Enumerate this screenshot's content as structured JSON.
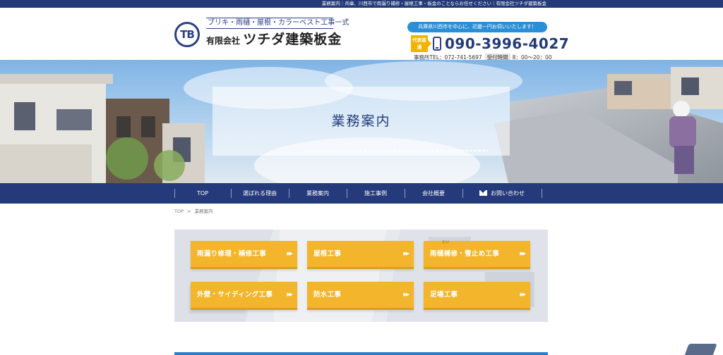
{
  "topbar": {
    "text": "業務案内｜兵庫、川西市で雨漏り補修・屋根工事・板金のことならお任せください｜有限会社ツチダ建築板金"
  },
  "header": {
    "logo_mark": "TB",
    "tagline": "ブリキ・雨樋・屋根・カラーベスト工事一式",
    "company_prefix": "有限会社",
    "company_name": "ツチダ建築板金",
    "area_banner": "兵庫県川西市を中心に、近畿一円お伺いいたします！",
    "direct_badge": "代表直通",
    "phone": "090-3996-4027",
    "office_tel": "事務所TEL：072-741-5697",
    "hours_label": "受付時間",
    "hours": "8：00〜20：00"
  },
  "hero": {
    "title": "業務案内"
  },
  "nav": {
    "items": [
      {
        "label": "TOP"
      },
      {
        "label": "選ばれる理由"
      },
      {
        "label": "業務案内"
      },
      {
        "label": "施工事例"
      },
      {
        "label": "会社概要"
      },
      {
        "label": "お問い合わせ",
        "icon": "mail-icon"
      }
    ]
  },
  "breadcrumb": {
    "home": "TOP",
    "separator": ">",
    "current": "業務案内"
  },
  "services": {
    "arrow": "▶▶",
    "ruby_text": "とい",
    "items": [
      {
        "label": "雨漏り修理・補修工事"
      },
      {
        "label": "屋根工事"
      },
      {
        "label": "雨樋補修・雪止め工事"
      },
      {
        "label": "外壁・サイディング工事"
      },
      {
        "label": "防水工事"
      },
      {
        "label": "足場工事"
      }
    ]
  },
  "colors": {
    "navy": "#253a7a",
    "accent_blue": "#2a8fd6",
    "service_yellow": "#f2b52b",
    "badge_yellow": "#f0b400"
  }
}
